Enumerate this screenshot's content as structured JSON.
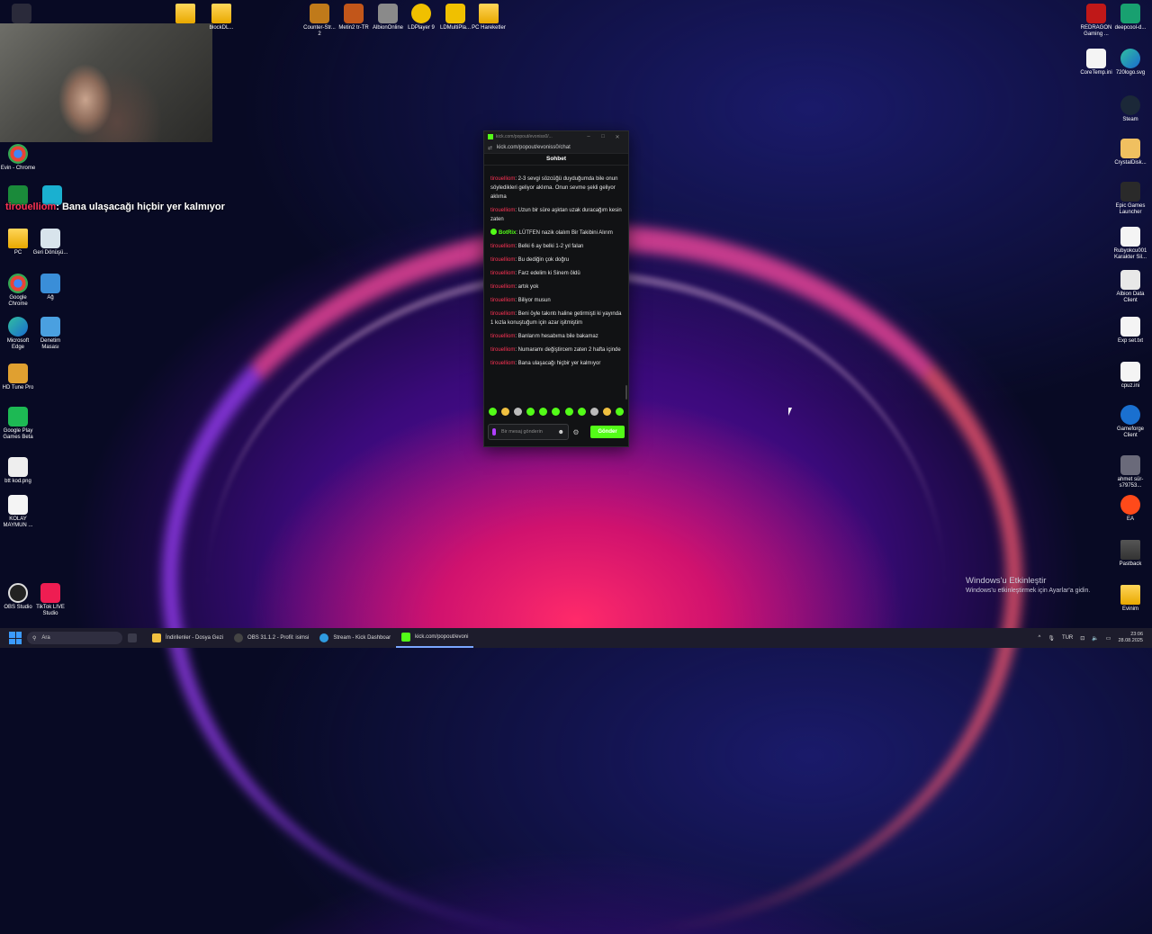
{
  "desktop": {
    "icons_top": [
      {
        "label": "Counter-Str... 2",
        "color": "#c07a1a"
      },
      {
        "label": "Metin2 tr-TR",
        "color": "#c2561a"
      },
      {
        "label": "AlbionOnline",
        "color": "#8a8a8a"
      },
      {
        "label": "LDPlayer 9",
        "color": "#f0c000"
      },
      {
        "label": "LDMultiPla...",
        "color": "#f0c000"
      },
      {
        "label": "PC Hareketler",
        "color": "#f0c850"
      }
    ],
    "folder_top": {
      "label": "blockDL..."
    },
    "icons_left": [
      {
        "label": "Evin - Chrome"
      },
      {
        "label": "PC"
      },
      {
        "label": "Geri Dönüşü..."
      },
      {
        "label": "Google Chrome"
      },
      {
        "label": "Ağ"
      },
      {
        "label": "Microsoft Edge"
      },
      {
        "label": "Denetim Masası"
      },
      {
        "label": "HD Tune Pro"
      },
      {
        "label": "Google Play Games Beta"
      },
      {
        "label": "btt kod.png"
      },
      {
        "label": "KOLAY MAYMUN ..."
      },
      {
        "label": "OBS Studio"
      },
      {
        "label": "TikTok LIVE Studio"
      }
    ],
    "icons_right": [
      {
        "label": "REDRAGON Gaming ..."
      },
      {
        "label": "deepcool-d..."
      },
      {
        "label": "CoreTemp.ini"
      },
      {
        "label": "720logo.svg"
      },
      {
        "label": "Steam"
      },
      {
        "label": "CrystalDisk..."
      },
      {
        "label": "Epic Games Launcher"
      },
      {
        "label": "Rubyokcu001 Karakter Sil..."
      },
      {
        "label": "Albion Data Client"
      },
      {
        "label": "Exp set.txt"
      },
      {
        "label": "cpuz.ini"
      },
      {
        "label": "Gameforge Client"
      },
      {
        "label": "ahmet sür-s79753..."
      },
      {
        "label": "EA"
      },
      {
        "label": "Pastback"
      },
      {
        "label": "Evinim"
      }
    ]
  },
  "overlay": {
    "user": "tirouelliom",
    "text": ": Bana ulaşacağı hiçbir yer kalmıyor"
  },
  "chat": {
    "window_title": "kick.com/popout/evoniss0/...",
    "url": "kick.com/popout/evoniss0/chat",
    "header": "Sohbet",
    "messages": [
      {
        "user": "tirouelliom",
        "text": ": 2-3 sevgi sözcüğü duyduğumda bile onun söyledikleri geliyor aklıma. Onun sevme şekli geliyor aklıma",
        "bot": false
      },
      {
        "user": "tirouelliom",
        "text": ": Uzun bir süre aşktan uzak duracağım kesin zaten",
        "bot": false
      },
      {
        "user": "BotRix",
        "text": ": LÜTFEN nazik olalım Bir Takibini Alırım",
        "bot": true
      },
      {
        "user": "tirouelliom",
        "text": ": Belki 6 ay belki 1-2 yıl falan",
        "bot": false
      },
      {
        "user": "tirouelliom",
        "text": ": Bu dediğin çok doğru",
        "bot": false
      },
      {
        "user": "tirouelliom",
        "text": ": Farz edelim ki Sinem öldü",
        "bot": false
      },
      {
        "user": "tirouelliom",
        "text": ": artık yok",
        "bot": false
      },
      {
        "user": "tirouelliom",
        "text": ": Biliyor musun",
        "bot": false
      },
      {
        "user": "tirouelliom",
        "text": ": Beni öyle takıntı haline getirmişti ki yayında 1 kızla konuştuğum için azar işitmiştim",
        "bot": false
      },
      {
        "user": "tirouelliom",
        "text": ": Banlarım hesabıma bile bakamaz",
        "bot": false
      },
      {
        "user": "tirouelliom",
        "text": ": Numaramı değiştircem zaten 2 hafta içinde",
        "bot": false
      },
      {
        "user": "tirouelliom",
        "text": ": Bana ulaşacağı hiçbir yer kalmıyor",
        "bot": false
      }
    ],
    "input_placeholder": "Bir mesaj gönderin",
    "send_label": "Gönder",
    "accent": "#53fc18"
  },
  "activation": {
    "title": "Windows'u Etkinleştir",
    "subtitle": "Windows'u etkinleştirmek için Ayarlar'a gidin."
  },
  "taskbar": {
    "search_placeholder": "Ara",
    "items": [
      {
        "label": "İndirilenler - Dosya Gezi",
        "color": "#f0c040",
        "active": false
      },
      {
        "label": "OBS 31.1.2 - Profil: isimsi",
        "color": "#444",
        "active": false
      },
      {
        "label": "Stream - Kick Dashboar",
        "color": "#2f9be0",
        "active": false
      },
      {
        "label": "kick.com/popout/evoni",
        "color": "#53fc18",
        "active": true
      }
    ],
    "language": "TUR",
    "time": "23:06",
    "date": "28.08.2025"
  }
}
